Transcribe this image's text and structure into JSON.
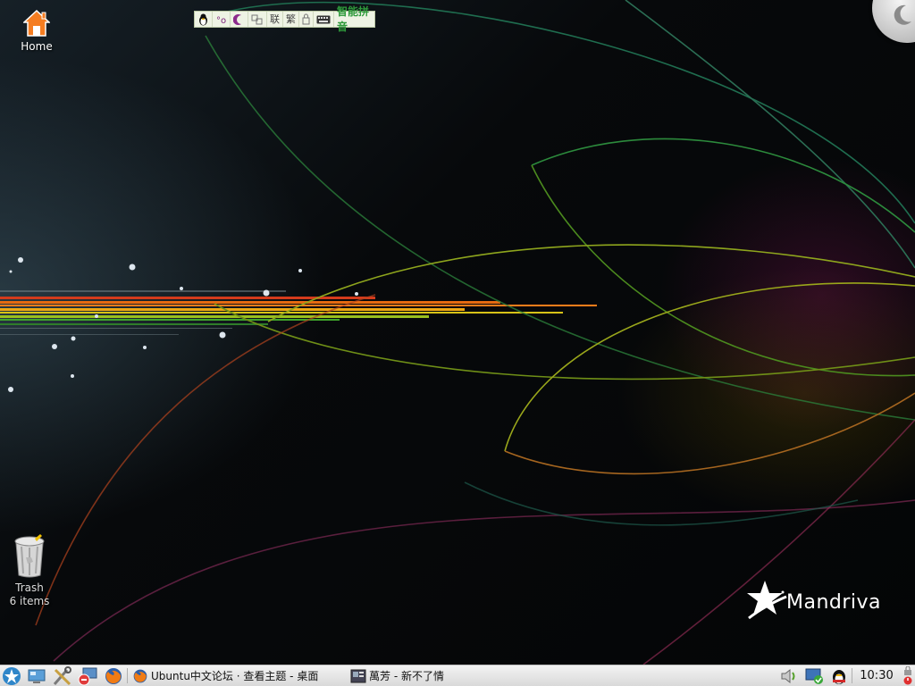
{
  "desktop": {
    "icons": [
      {
        "label": "Home"
      },
      {
        "label": "Trash",
        "sublabel": "6 items"
      }
    ]
  },
  "ime": {
    "name": "智能拼音",
    "btn_lian": "联",
    "btn_fan": "繁"
  },
  "logo": {
    "text": "Mandriva"
  },
  "taskbar": {
    "tasks": [
      {
        "label": "Ubuntu中文论坛 · 查看主题 - 桌面"
      },
      {
        "label": "萬芳 - 新不了情"
      }
    ],
    "clock": "10:30"
  },
  "colors": {
    "taskbar_bg": "#e6e6e6",
    "ime_green": "#2e9a3b",
    "desktop_bg": "#050607"
  }
}
